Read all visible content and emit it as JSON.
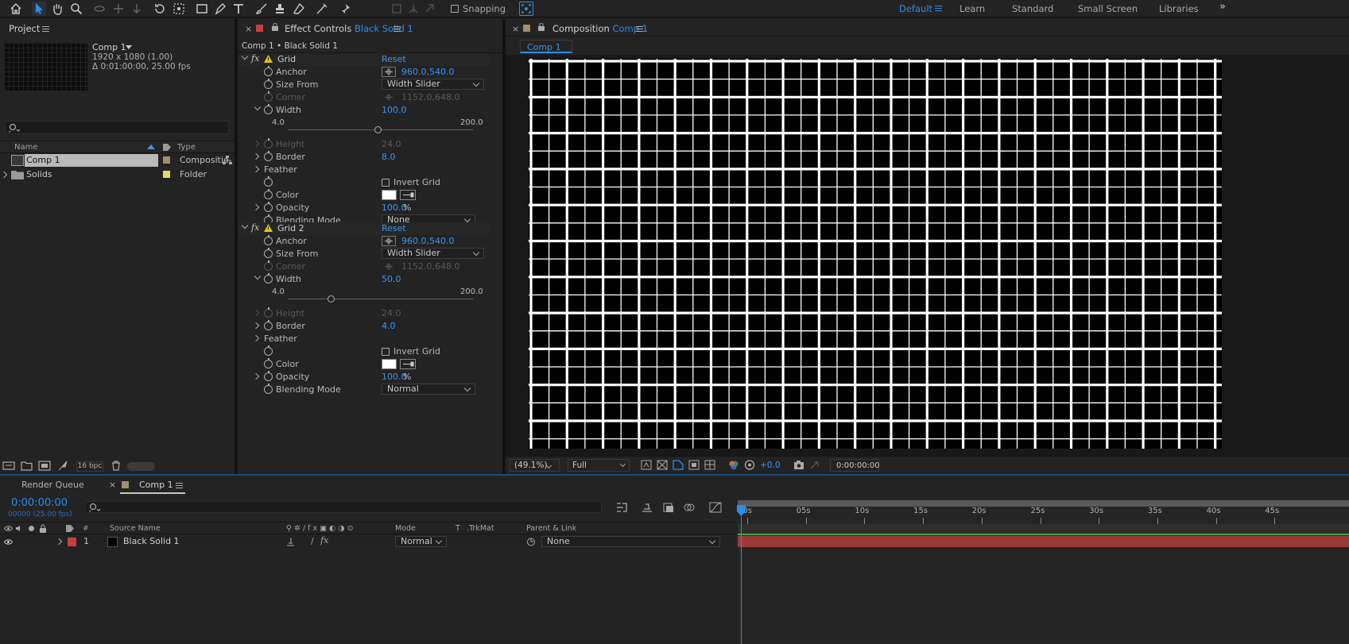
{
  "toolbar": {
    "snapping_label": "Snapping",
    "workspaces": [
      "Default",
      "Learn",
      "Standard",
      "Small Screen",
      "Libraries"
    ]
  },
  "project": {
    "title": "Project",
    "comp_name": "Comp 1",
    "comp_info_1": "1920 x 1080 (1.00)",
    "comp_info_2": "Δ 0:01:00:00, 25.00 fps",
    "col_name": "Name",
    "col_type": "Type",
    "items": [
      {
        "name": "Comp 1",
        "type": "Compositio",
        "label_color": "#a18e6a"
      },
      {
        "name": "Solids",
        "type": "Folder",
        "label_color": "#e3d96b"
      }
    ],
    "bpc": "16 bpc"
  },
  "effects": {
    "tab_title": "Effect Controls",
    "tab_layer": "Black Solid 1",
    "breadcrumb": "Comp 1 • Black Solid 1",
    "reset_label": "Reset",
    "grid1": {
      "name": "Grid",
      "anchor_label": "Anchor",
      "anchor_value": "960.0,540.0",
      "size_from_label": "Size From",
      "size_from_value": "Width Slider",
      "corner_label": "Corner",
      "corner_value": "1152.0,648.0",
      "width_label": "Width",
      "width_value": "100.0",
      "slider_min": "4.0",
      "slider_max": "200.0",
      "width_fraction": 0.49,
      "height_label": "Height",
      "height_value": "24.0",
      "border_label": "Border",
      "border_value": "8.0",
      "feather_label": "Feather",
      "invert_label": "Invert Grid",
      "color_label": "Color",
      "opacity_label": "Opacity",
      "opacity_value": "100.0",
      "opacity_unit": "%",
      "blend_label": "Blending Mode",
      "blend_value": "None"
    },
    "grid2": {
      "name": "Grid 2",
      "anchor_label": "Anchor",
      "anchor_value": "960.0,540.0",
      "size_from_label": "Size From",
      "size_from_value": "Width Slider",
      "corner_label": "Corner",
      "corner_value": "1152.0,648.0",
      "width_label": "Width",
      "width_value": "50.0",
      "slider_min": "4.0",
      "slider_max": "200.0",
      "width_fraction": 0.235,
      "height_label": "Height",
      "height_value": "24.0",
      "border_label": "Border",
      "border_value": "4.0",
      "feather_label": "Feather",
      "invert_label": "Invert Grid",
      "color_label": "Color",
      "opacity_label": "Opacity",
      "opacity_value": "100.0",
      "opacity_unit": "%",
      "blend_label": "Blending Mode",
      "blend_value": "Normal"
    }
  },
  "composition": {
    "tab_title": "Composition",
    "tab_comp": "Comp 1",
    "subtab": "Comp 1",
    "zoom": "(49.1%)",
    "resolution": "Full",
    "exposure": "+0.0",
    "timecode": "0:00:00:00"
  },
  "timeline": {
    "render_queue_tab": "Render Queue",
    "comp_tab": "Comp 1",
    "current_time": "0:00:00:00",
    "frames": "00000 (25.00 fps)",
    "col_hash": "#",
    "col_source": "Source Name",
    "col_mode": "Mode",
    "col_t": "T",
    "col_trkmat": ".TrkMat",
    "col_parent": "Parent & Link",
    "ruler_labels": [
      "00s",
      "05s",
      "10s",
      "15s",
      "20s",
      "25s",
      "30s",
      "35s",
      "40s",
      "45s"
    ],
    "layer": {
      "index": "1",
      "name": "Black Solid 1",
      "mode": "Normal",
      "parent": "None",
      "label_color": "#c6403f",
      "bar_color": "#9c3a3a"
    }
  }
}
